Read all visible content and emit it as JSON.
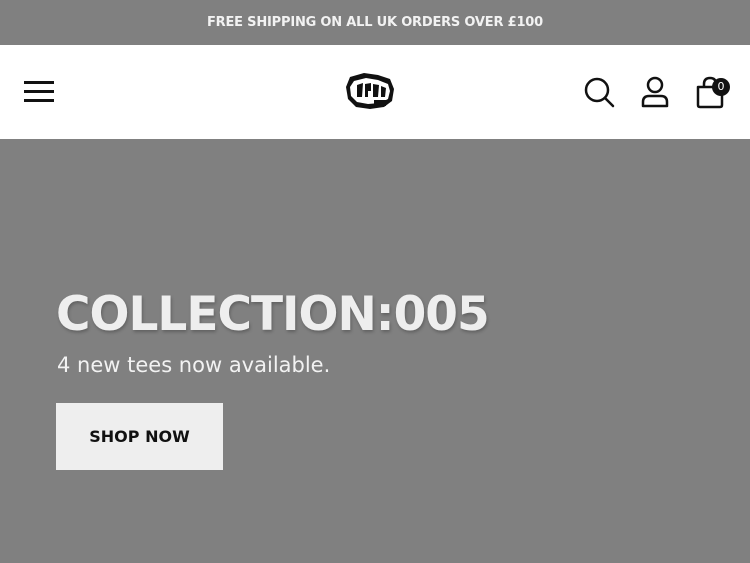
{
  "announcement": {
    "text": "FREE SHIPPING ON ALL UK ORDERS OVER £100"
  },
  "header": {
    "logo_icon": "brand-logo-icon",
    "icons": {
      "menu": "hamburger-menu-icon",
      "search": "search-icon",
      "account": "user-icon",
      "cart": "shopping-bag-icon"
    },
    "cart_count": "0"
  },
  "hero": {
    "title": "COLLECTION:005",
    "subtitle": "4 new tees now available.",
    "cta_label": "SHOP NOW",
    "background_color": "#808080"
  }
}
